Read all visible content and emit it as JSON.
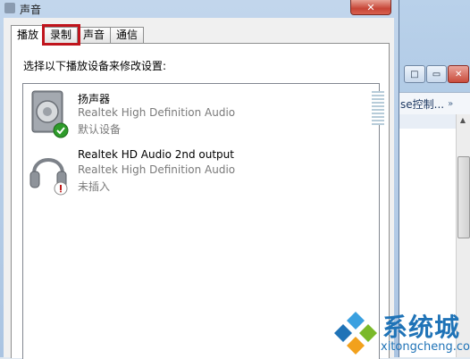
{
  "dialog": {
    "title": "声音",
    "close_label": "✕",
    "tabs": [
      {
        "label": "播放",
        "active": true
      },
      {
        "label": "录制",
        "highlighted": true
      },
      {
        "label": "声音"
      },
      {
        "label": "通信"
      }
    ],
    "instruction": "选择以下播放设备来修改设置:",
    "devices": [
      {
        "name": "扬声器",
        "description": "Realtek High Definition Audio",
        "status": "默认设备",
        "icon": "speaker-icon",
        "badge": "default-check-icon"
      },
      {
        "name": "Realtek HD Audio 2nd output",
        "description": "Realtek High Definition Audio",
        "status": "未插入",
        "icon": "headphones-icon",
        "badge": "unplugged-icon"
      }
    ]
  },
  "background_window": {
    "caption_buttons": [
      "□",
      "▭",
      "✕"
    ],
    "toolbar_text": "se控制...",
    "toolbar_chevron": "»"
  },
  "watermark": {
    "text_cn": "系统城",
    "text_en": "xitongcheng.com"
  },
  "colors": {
    "highlight_box": "#c0141c",
    "check_badge": "#2e9b2a",
    "unplugged_badge": "#c01a1a",
    "watermark": "#1f73b7"
  }
}
